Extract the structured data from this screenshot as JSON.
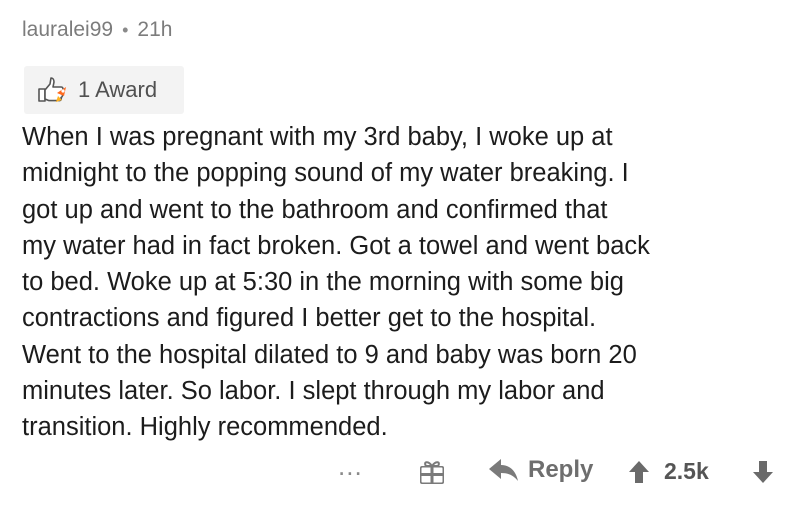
{
  "comment": {
    "author": "lauralei99",
    "separator": "•",
    "age": "21h",
    "award": {
      "icon": "helpful-award-icon",
      "label": "1 Award"
    },
    "body_lines": [
      "When I was pregnant with my 3rd baby, I woke up at",
      "midnight to the popping sound of my water breaking. I",
      "got up and went to the bathroom and confirmed that",
      "my water had in fact broken. Got a towel and went back",
      "to bed. Woke up at 5:30 in the morning with some big",
      "contractions and figured I better get to the hospital.",
      "Went to the hospital dilated to 9 and baby was born 20",
      "minutes later. So labor. I slept through my labor and",
      "transition. Highly recommended."
    ],
    "actions": {
      "more_label": "...",
      "gift_icon": "gift-icon",
      "reply_label": "Reply",
      "reply_icon": "reply-arrow-icon",
      "upvote_icon": "upvote-arrow-icon",
      "score": "2.5k",
      "downvote_icon": "downvote-arrow-icon"
    }
  },
  "colors": {
    "meta_text": "#7c7c7c",
    "body_text": "#1c1c1c",
    "badge_bg": "#f3f3f3",
    "action_gray": "#7a7a7a"
  }
}
